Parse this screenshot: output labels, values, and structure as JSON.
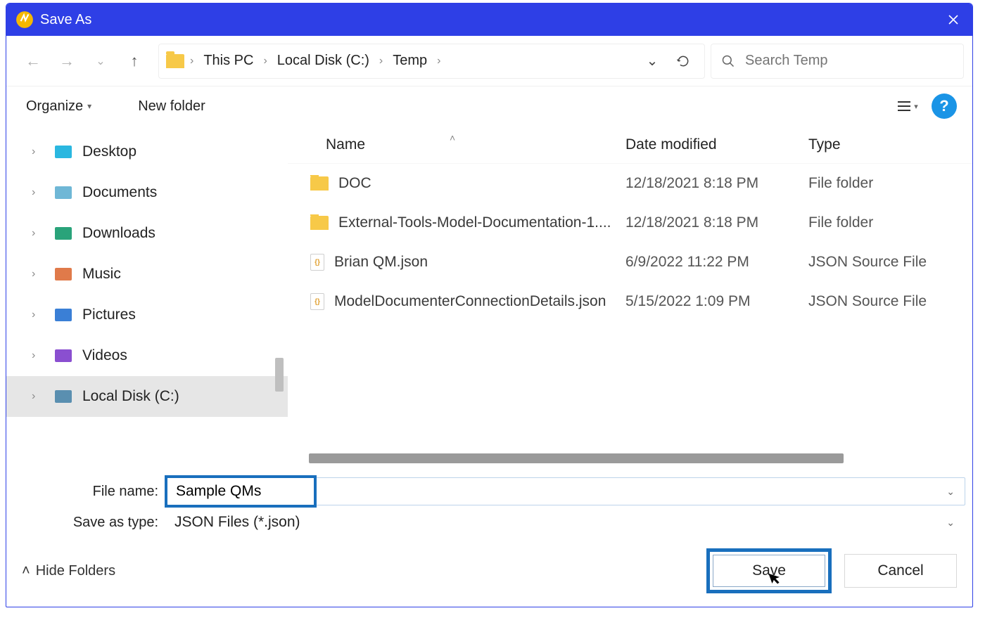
{
  "titlebar": {
    "title": "Save As"
  },
  "nav": {
    "breadcrumbs": [
      "This PC",
      "Local Disk (C:)",
      "Temp"
    ],
    "search_placeholder": "Search Temp"
  },
  "toolbar": {
    "organize": "Organize",
    "new_folder": "New folder"
  },
  "tree": {
    "items": [
      {
        "label": "Desktop",
        "icon": "desktop",
        "selected": false,
        "color": "#2ab7e0"
      },
      {
        "label": "Documents",
        "icon": "documents",
        "selected": false,
        "color": "#6fb7d6"
      },
      {
        "label": "Downloads",
        "icon": "downloads",
        "selected": false,
        "color": "#2aa37a"
      },
      {
        "label": "Music",
        "icon": "music",
        "selected": false,
        "color": "#e07a4a"
      },
      {
        "label": "Pictures",
        "icon": "pictures",
        "selected": false,
        "color": "#3a7fd6"
      },
      {
        "label": "Videos",
        "icon": "videos",
        "selected": false,
        "color": "#8a4fd0"
      },
      {
        "label": "Local Disk (C:)",
        "icon": "drive",
        "selected": true,
        "color": "#5a8fb0"
      }
    ]
  },
  "columns": {
    "name": "Name",
    "date": "Date modified",
    "type": "Type"
  },
  "files": [
    {
      "name": "DOC",
      "date": "12/18/2021 8:18 PM",
      "type": "File folder",
      "kind": "folder"
    },
    {
      "name": "External-Tools-Model-Documentation-1....",
      "date": "12/18/2021 8:18 PM",
      "type": "File folder",
      "kind": "folder"
    },
    {
      "name": "Brian QM.json",
      "date": "6/9/2022 11:22 PM",
      "type": "JSON Source File",
      "kind": "json"
    },
    {
      "name": "ModelDocumenterConnectionDetails.json",
      "date": "5/15/2022 1:09 PM",
      "type": "JSON Source File",
      "kind": "json"
    }
  ],
  "form": {
    "file_name_label": "File name:",
    "file_name_value": "Sample QMs",
    "save_as_type_label": "Save as type:",
    "save_as_type_value": "JSON Files (*.json)"
  },
  "footer": {
    "hide_folders": "Hide Folders",
    "save": "Save",
    "cancel": "Cancel"
  }
}
